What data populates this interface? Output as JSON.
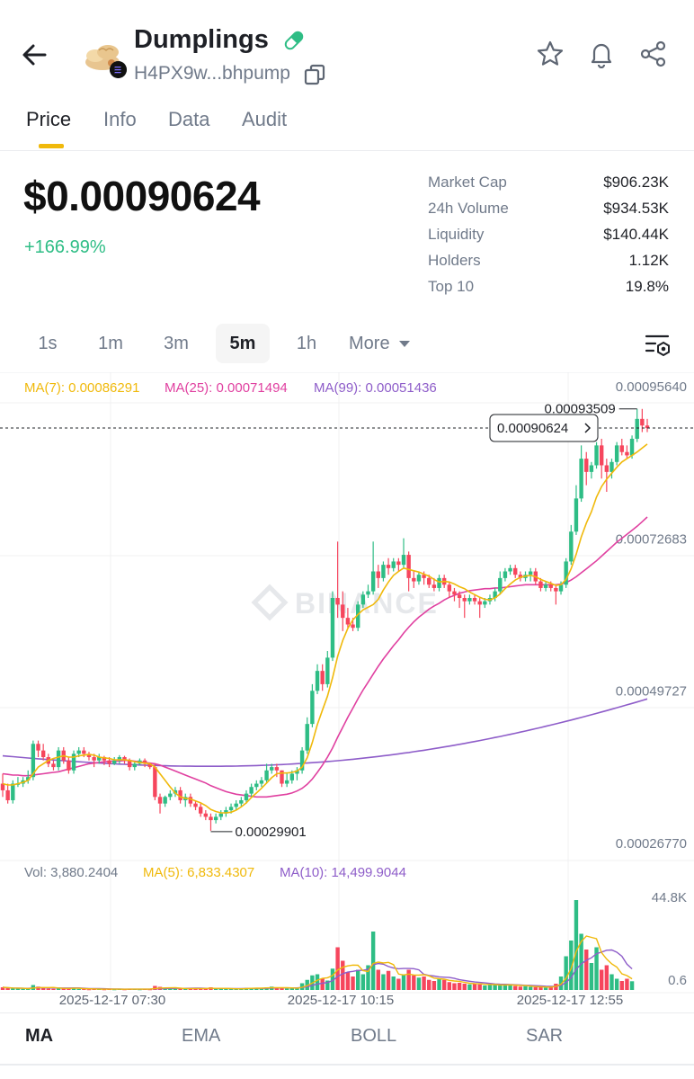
{
  "header": {
    "back_icon": "arrow-left-icon",
    "token_name": "Dumplings",
    "address": "H4PX9w...bhpump",
    "icons": [
      "star-icon",
      "bell-icon",
      "share-icon"
    ]
  },
  "tabs": [
    {
      "label": "Price",
      "active": true
    },
    {
      "label": "Info",
      "active": false
    },
    {
      "label": "Data",
      "active": false
    },
    {
      "label": "Audit",
      "active": false
    }
  ],
  "price": {
    "value": "$0.00090624",
    "change": "+166.99%",
    "change_color": "#2ebd85"
  },
  "stats": [
    {
      "label": "Market Cap",
      "value": "$906.23K"
    },
    {
      "label": "24h Volume",
      "value": "$934.53K"
    },
    {
      "label": "Liquidity",
      "value": "$140.44K"
    },
    {
      "label": "Holders",
      "value": "1.12K"
    },
    {
      "label": "Top 10",
      "value": "19.8%"
    }
  ],
  "intervals": [
    {
      "label": "1s",
      "active": false
    },
    {
      "label": "1m",
      "active": false
    },
    {
      "label": "3m",
      "active": false
    },
    {
      "label": "5m",
      "active": true
    },
    {
      "label": "1h",
      "active": false
    },
    {
      "label": "More",
      "active": false
    }
  ],
  "indicators": [
    {
      "label": "MA",
      "active": true
    },
    {
      "label": "EMA",
      "active": false
    },
    {
      "label": "BOLL",
      "active": false
    },
    {
      "label": "SAR",
      "active": false
    }
  ],
  "colors": {
    "up": "#2ebd85",
    "down": "#f6465d",
    "ma7": "#f0b90b",
    "ma25": "#e040a0",
    "ma99": "#8e5dc9",
    "accent": "#f0b90b"
  },
  "chart_data": {
    "type": "candlestick",
    "ma_legend": [
      {
        "label": "MA(7): 0.00086291",
        "color": "#f0b90b"
      },
      {
        "label": "MA(25): 0.00071494",
        "color": "#e040a0"
      },
      {
        "label": "MA(99): 0.00051436",
        "color": "#8e5dc9"
      }
    ],
    "y_ticks": [
      "0.00095640",
      "0.00072683",
      "0.00049727",
      "0.00026770"
    ],
    "y_tick_values": [
      0.0009564,
      0.00072683,
      0.00049727,
      0.0002677
    ],
    "ylim": [
      0.0002677,
      0.0009564
    ],
    "current_price_label": "0.00090624",
    "current_price": 0.00090624,
    "high_label": "0.00093509",
    "high_value": 0.00093509,
    "low_label": "0.00029901",
    "low_value": 0.00029901,
    "watermark": "BINANCE",
    "x_ticks": [
      "2025-12-17 07:30",
      "2025-12-17 10:15",
      "2025-12-17 12:55"
    ],
    "candles": [
      [
        0.00037,
        0.00036,
        0.000385,
        0.00035
      ],
      [
        0.00036,
        0.000345,
        0.00037,
        0.00034
      ],
      [
        0.000345,
        0.00037,
        0.000375,
        0.00034
      ],
      [
        0.00037,
        0.00037,
        0.00038,
        0.000365
      ],
      [
        0.00037,
        0.000375,
        0.00038,
        0.000365
      ],
      [
        0.000375,
        0.00038,
        0.00039,
        0.00037
      ],
      [
        0.00038,
        0.00043,
        0.000435,
        0.000375
      ],
      [
        0.00043,
        0.00042,
        0.000435,
        0.00041
      ],
      [
        0.00042,
        0.00041,
        0.00043,
        0.000405
      ],
      [
        0.00041,
        0.0004,
        0.000415,
        0.000395
      ],
      [
        0.0004,
        0.000395,
        0.000405,
        0.00039
      ],
      [
        0.000395,
        0.00042,
        0.000425,
        0.00039
      ],
      [
        0.00042,
        0.000405,
        0.000425,
        0.0004
      ],
      [
        0.000405,
        0.00039,
        0.00041,
        0.000385
      ],
      [
        0.00039,
        0.000415,
        0.00042,
        0.000385
      ],
      [
        0.000415,
        0.00042,
        0.000425,
        0.00041
      ],
      [
        0.00042,
        0.000415,
        0.000425,
        0.00041
      ],
      [
        0.000415,
        0.00041,
        0.000418,
        0.000405
      ],
      [
        0.00041,
        0.000405,
        0.000415,
        0.000395
      ],
      [
        0.000405,
        0.00041,
        0.000415,
        0.0004
      ],
      [
        0.00041,
        0.000405,
        0.000412,
        0.000398
      ],
      [
        0.000405,
        0.0004,
        0.00041,
        0.000395
      ],
      [
        0.0004,
        0.000405,
        0.00041,
        0.000398
      ],
      [
        0.000405,
        0.00041,
        0.000413,
        0.0004
      ],
      [
        0.00041,
        0.000405,
        0.000412,
        0.0004
      ],
      [
        0.000405,
        0.000395,
        0.000408,
        0.00039
      ],
      [
        0.000395,
        0.0004,
        0.000403,
        0.00039
      ],
      [
        0.0004,
        0.000405,
        0.000408,
        0.000398
      ],
      [
        0.000405,
        0.0004,
        0.000408,
        0.000395
      ],
      [
        0.0004,
        0.000395,
        0.000402,
        0.000392
      ],
      [
        0.000395,
        0.00035,
        0.0004,
        0.000345
      ],
      [
        0.00035,
        0.00034,
        0.000355,
        0.000325
      ],
      [
        0.00034,
        0.00035,
        0.000352,
        0.000335
      ],
      [
        0.00035,
        0.000355,
        0.00036,
        0.000345
      ],
      [
        0.000355,
        0.00036,
        0.000365,
        0.00035
      ],
      [
        0.00036,
        0.000345,
        0.000365,
        0.00034
      ],
      [
        0.000345,
        0.00035,
        0.000355,
        0.000335
      ],
      [
        0.00035,
        0.00034,
        0.000355,
        0.000335
      ],
      [
        0.00034,
        0.000335,
        0.000345,
        0.00033
      ],
      [
        0.000335,
        0.000325,
        0.00034,
        0.00032
      ],
      [
        0.000325,
        0.00032,
        0.00033,
        0.000315
      ],
      [
        0.00032,
        0.000315,
        0.000325,
        0.000299
      ],
      [
        0.000315,
        0.00032,
        0.000325,
        0.00031
      ],
      [
        0.00032,
        0.000325,
        0.00033,
        0.000315
      ],
      [
        0.000325,
        0.00033,
        0.000335,
        0.00032
      ],
      [
        0.00033,
        0.000335,
        0.00034,
        0.000325
      ],
      [
        0.000335,
        0.00034,
        0.000345,
        0.00033
      ],
      [
        0.00034,
        0.000345,
        0.00035,
        0.000335
      ],
      [
        0.000345,
        0.000355,
        0.00036,
        0.00034
      ],
      [
        0.000355,
        0.000365,
        0.00037,
        0.00035
      ],
      [
        0.000365,
        0.00037,
        0.000375,
        0.00036
      ],
      [
        0.00037,
        0.000375,
        0.00038,
        0.000365
      ],
      [
        0.000375,
        0.00039,
        0.0004,
        0.00037
      ],
      [
        0.00039,
        0.000395,
        0.0004,
        0.000385
      ],
      [
        0.000395,
        0.00039,
        0.0004,
        0.00038
      ],
      [
        0.00039,
        0.00037,
        0.00039,
        0.000365
      ],
      [
        0.00037,
        0.000375,
        0.000385,
        0.000365
      ],
      [
        0.000375,
        0.000385,
        0.00039,
        0.00037
      ],
      [
        0.000385,
        0.00039,
        0.000395,
        0.000375
      ],
      [
        0.00039,
        0.00042,
        0.000425,
        0.000385
      ],
      [
        0.00042,
        0.00046,
        0.00047,
        0.000415
      ],
      [
        0.00046,
        0.00051,
        0.00052,
        0.000455
      ],
      [
        0.00051,
        0.00054,
        0.00055,
        0.000505
      ],
      [
        0.00054,
        0.00052,
        0.00055,
        0.00051
      ],
      [
        0.00052,
        0.00056,
        0.00057,
        0.000515
      ],
      [
        0.00056,
        0.00065,
        0.00066,
        0.000555
      ],
      [
        0.00065,
        0.00064,
        0.000735,
        0.00062
      ],
      [
        0.00064,
        0.00062,
        0.00066,
        0.0006
      ],
      [
        0.00062,
        0.00061,
        0.000635,
        0.000605
      ],
      [
        0.00061,
        0.000605,
        0.00062,
        0.0006
      ],
      [
        0.000605,
        0.00064,
        0.000645,
        0.0006
      ],
      [
        0.00064,
        0.000655,
        0.00066,
        0.000635
      ],
      [
        0.000655,
        0.00066,
        0.00067,
        0.00065
      ],
      [
        0.00066,
        0.00069,
        0.000735,
        0.000655
      ],
      [
        0.00069,
        0.00068,
        0.0007,
        0.000665
      ],
      [
        0.00068,
        0.0007,
        0.000705,
        0.000675
      ],
      [
        0.0007,
        0.000695,
        0.00071,
        0.000685
      ],
      [
        0.000695,
        0.000705,
        0.00071,
        0.00069
      ],
      [
        0.000705,
        0.0007,
        0.00071,
        0.00069
      ],
      [
        0.0007,
        0.000715,
        0.00074,
        0.000695
      ],
      [
        0.000715,
        0.00068,
        0.00072,
        0.00066
      ],
      [
        0.00068,
        0.000675,
        0.00069,
        0.000665
      ],
      [
        0.000675,
        0.000685,
        0.00069,
        0.00067
      ],
      [
        0.000685,
        0.00068,
        0.00069,
        0.00067
      ],
      [
        0.00068,
        0.00067,
        0.000685,
        0.000665
      ],
      [
        0.00067,
        0.000665,
        0.00068,
        0.00066
      ],
      [
        0.000665,
        0.00068,
        0.000685,
        0.00066
      ],
      [
        0.00068,
        0.00067,
        0.000685,
        0.000665
      ],
      [
        0.00067,
        0.00066,
        0.000675,
        0.00065
      ],
      [
        0.00066,
        0.000655,
        0.000665,
        0.000645
      ],
      [
        0.000655,
        0.00065,
        0.00066,
        0.000635
      ],
      [
        0.00065,
        0.000645,
        0.000655,
        0.00062
      ],
      [
        0.000645,
        0.00065,
        0.000655,
        0.00064
      ],
      [
        0.00065,
        0.000645,
        0.000655,
        0.00064
      ],
      [
        0.000645,
        0.00064,
        0.00065,
        0.00062
      ],
      [
        0.00064,
        0.000645,
        0.00065,
        0.000635
      ],
      [
        0.000645,
        0.00065,
        0.000655,
        0.00064
      ],
      [
        0.00065,
        0.00066,
        0.000665,
        0.000645
      ],
      [
        0.00066,
        0.00068,
        0.00069,
        0.000655
      ],
      [
        0.00068,
        0.00069,
        0.000695,
        0.000675
      ],
      [
        0.00069,
        0.000695,
        0.0007,
        0.000685
      ],
      [
        0.000695,
        0.000685,
        0.0007,
        0.00068
      ],
      [
        0.000685,
        0.00068,
        0.00069,
        0.000675
      ],
      [
        0.00068,
        0.000685,
        0.00069,
        0.000675
      ],
      [
        0.000685,
        0.00069,
        0.000695,
        0.000675
      ],
      [
        0.00069,
        0.000675,
        0.000695,
        0.00067
      ],
      [
        0.000675,
        0.000665,
        0.00068,
        0.00066
      ],
      [
        0.000665,
        0.00067,
        0.000675,
        0.00066
      ],
      [
        0.00067,
        0.000665,
        0.000675,
        0.00066
      ],
      [
        0.000665,
        0.00066,
        0.00067,
        0.00064
      ],
      [
        0.00066,
        0.00067,
        0.000675,
        0.000655
      ],
      [
        0.00067,
        0.000705,
        0.00071,
        0.000665
      ],
      [
        0.000705,
        0.00075,
        0.00076,
        0.0007
      ],
      [
        0.00075,
        0.0008,
        0.00082,
        0.000745
      ],
      [
        0.0008,
        0.00086,
        0.00088,
        0.000795
      ],
      [
        0.00086,
        0.00084,
        0.00087,
        0.00082
      ],
      [
        0.00084,
        0.00085,
        0.000855,
        0.00083
      ],
      [
        0.00085,
        0.00088,
        0.000885,
        0.000845
      ],
      [
        0.00088,
        0.00085,
        0.00089,
        0.00083
      ],
      [
        0.00085,
        0.00084,
        0.00086,
        0.00081
      ],
      [
        0.00084,
        0.000855,
        0.00086,
        0.00083
      ],
      [
        0.000855,
        0.00088,
        0.000885,
        0.00085
      ],
      [
        0.00088,
        0.00087,
        0.00089,
        0.000865
      ],
      [
        0.00087,
        0.000865,
        0.00088,
        0.00086
      ],
      [
        0.000865,
        0.00089,
        0.000895,
        0.00086
      ],
      [
        0.00089,
        0.00092,
        0.000935,
        0.000885
      ],
      [
        0.00092,
        0.00091,
        0.000935,
        0.0009
      ],
      [
        0.00091,
        0.000906,
        0.00092,
        0.0009
      ]
    ],
    "ma7": [
      0.00037,
      0.000368,
      0.000368,
      0.00037,
      0.000372,
      0.000375,
      0.000385,
      0.000395,
      0.0004,
      0.000405,
      0.000408,
      0.00041,
      0.000412,
      0.00041,
      0.00041,
      0.000412,
      0.000413,
      0.000414,
      0.000413,
      0.00041,
      0.000409,
      0.000408,
      0.000406,
      0.000406,
      0.000406,
      0.000405,
      0.000403,
      0.000402,
      0.000401,
      0.0004,
      0.000395,
      0.000385,
      0.000375,
      0.000365,
      0.000356,
      0.00035,
      0.000348,
      0.000347,
      0.000344,
      0.000341,
      0.000337,
      0.000331,
      0.000328,
      0.000326,
      0.000326,
      0.000327,
      0.00033,
      0.000335,
      0.000341,
      0.000349,
      0.000356,
      0.000363,
      0.000371,
      0.000379,
      0.000385,
      0.000386,
      0.000386,
      0.000387,
      0.000389,
      0.000395,
      0.000409,
      0.000432,
      0.000459,
      0.000481,
      0.000502,
      0.00053,
      0.000562,
      0.000586,
      0.000604,
      0.000617,
      0.000625,
      0.000632,
      0.000636,
      0.00064,
      0.000648,
      0.000662,
      0.000674,
      0.000684,
      0.00069,
      0.000695,
      0.000693,
      0.000691,
      0.000689,
      0.000686,
      0.000683,
      0.000678,
      0.000674,
      0.000675,
      0.000674,
      0.000671,
      0.000667,
      0.000664,
      0.000659,
      0.000655,
      0.000651,
      0.000648,
      0.000647,
      0.00065,
      0.000656,
      0.000664,
      0.000671,
      0.000677,
      0.000681,
      0.000683,
      0.000684,
      0.000682,
      0.000678,
      0.000675,
      0.000672,
      0.000669,
      0.00067,
      0.000678,
      0.000694,
      0.000716,
      0.000742,
      0.000763,
      0.00078,
      0.000802,
      0.000818,
      0.000829,
      0.000838,
      0.000847,
      0.000855,
      0.00086,
      0.000865,
      0.00087,
      0.000876,
      0.000882
    ],
    "ma25": [
      0.000385,
      0.000384,
      0.000383,
      0.000383,
      0.000382,
      0.000382,
      0.000383,
      0.000384,
      0.000385,
      0.000386,
      0.000387,
      0.000388,
      0.00039,
      0.000392,
      0.000394,
      0.000396,
      0.000398,
      0.0004,
      0.000401,
      0.000402,
      0.000403,
      0.000404,
      0.000404,
      0.000404,
      0.000405,
      0.000405,
      0.000404,
      0.000403,
      0.000402,
      0.000401,
      0.0004,
      0.000398,
      0.000395,
      0.000392,
      0.000389,
      0.000386,
      0.000383,
      0.00038,
      0.000377,
      0.000374,
      0.000371,
      0.000367,
      0.000364,
      0.000361,
      0.000358,
      0.000356,
      0.000354,
      0.000353,
      0.000352,
      0.000351,
      0.00035,
      0.00035,
      0.00035,
      0.000351,
      0.000352,
      0.000353,
      0.000354,
      0.000356,
      0.000359,
      0.000363,
      0.000369,
      0.000377,
      0.000387,
      0.000398,
      0.00041,
      0.000424,
      0.00044,
      0.000455,
      0.00047,
      0.000484,
      0.000498,
      0.000511,
      0.000523,
      0.000535,
      0.000547,
      0.000558,
      0.000568,
      0.000578,
      0.000587,
      0.000597,
      0.000606,
      0.000614,
      0.000621,
      0.000627,
      0.000633,
      0.000638,
      0.000642,
      0.000647,
      0.000651,
      0.000654,
      0.000657,
      0.000659,
      0.000661,
      0.000662,
      0.000663,
      0.000664,
      0.000664,
      0.000665,
      0.000665,
      0.000666,
      0.000667,
      0.000668,
      0.000669,
      0.00067,
      0.00067,
      0.00067,
      0.00067,
      0.00067,
      0.00067,
      0.00067,
      0.000671,
      0.000673,
      0.000677,
      0.000682,
      0.000688,
      0.000694,
      0.0007,
      0.000706,
      0.000713,
      0.00072,
      0.000727,
      0.000734,
      0.00074,
      0.000746,
      0.000752,
      0.000758,
      0.000765,
      0.000772
    ],
    "volume_legend": [
      {
        "label": "Vol: 3,880.2404",
        "color": "#707a8a"
      },
      {
        "label": "MA(5): 6,833.4307",
        "color": "#f0b90b"
      },
      {
        "label": "MA(10): 14,499.9044",
        "color": "#8e5dc9"
      }
    ],
    "volume_ticks": [
      "44.8K",
      "0.6"
    ],
    "volume_ylim": [
      0.6,
      44800
    ],
    "volumes": [
      1200,
      900,
      600,
      700,
      500,
      400,
      2200,
      1500,
      800,
      600,
      500,
      1100,
      700,
      600,
      900,
      500,
      400,
      300,
      400,
      500,
      300,
      400,
      300,
      400,
      300,
      500,
      400,
      300,
      400,
      300,
      1800,
      1400,
      700,
      600,
      500,
      800,
      600,
      700,
      600,
      500,
      800,
      1200,
      600,
      500,
      400,
      500,
      600,
      700,
      900,
      1000,
      800,
      700,
      1200,
      1500,
      800,
      1000,
      600,
      700,
      800,
      3000,
      4500,
      6500,
      7000,
      5000,
      4200,
      9500,
      19000,
      13000,
      8000,
      6000,
      9000,
      7000,
      11000,
      26000,
      9000,
      7000,
      8500,
      6000,
      5000,
      7000,
      9000,
      6500,
      5500,
      6000,
      4500,
      4000,
      5000,
      4500,
      3500,
      3000,
      3200,
      2800,
      2500,
      2800,
      2500,
      2000,
      2500,
      2200,
      2000,
      2600,
      2200,
      1800,
      1500,
      1700,
      1400,
      1300,
      1200,
      1100,
      1500,
      2800,
      6000,
      15000,
      22000,
      40000,
      25000,
      18000,
      12000,
      19000,
      9000,
      11000,
      7000,
      5000,
      4000,
      5000,
      3880
    ]
  }
}
